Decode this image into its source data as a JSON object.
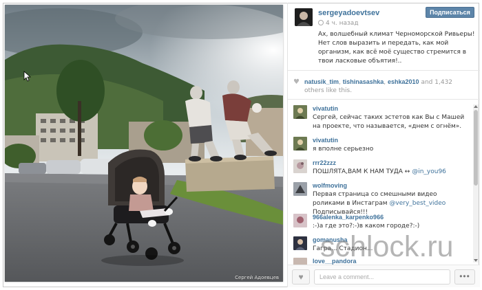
{
  "post": {
    "username": "sergeyadoevtsev",
    "time_ago": "4 ч. назад",
    "follow_label": "Подписаться",
    "caption": "Ах, волшебный климат Черноморской Ривьеры! Нет слов выразить и передать, как мой организм, как всё моё существо стремится в твои ласковые объятия!..",
    "photo_credit": "Сергей Адоевцев"
  },
  "likes": {
    "user1": "natusik_tim",
    "user2": "tishinasashka",
    "user3": "eshka2010",
    "and_text": "and",
    "count": "1,432",
    "others_text": "others like this."
  },
  "comments": [
    {
      "user": "vivatutin",
      "text": "Сергей, сейчас таких эстетов как Вы с Машей на проекте, что называется, «днем с огнём»."
    },
    {
      "user": "vivatutin",
      "text": "я вполне серьезно"
    },
    {
      "user": "rrr22zzz",
      "text_before": "ПОШЛЯТА,ВАМ К НАМ ТУДА ↔ ",
      "mention": "@in_you96",
      "text_after": ""
    },
    {
      "user": "wolfmoving",
      "text_before": "Первая страница со смешными видео роликами в Инстаграм ",
      "mention": "@very_best_video",
      "text_after": " Подписывайся!!!"
    },
    {
      "user": "966alenka_karpenko966",
      "text": ":-)а где это?:-)в каком городе?:-)"
    },
    {
      "user": "gomanusha",
      "text": "Гагра... Стадион..."
    },
    {
      "user": "love__pandora",
      "text": ""
    }
  ],
  "footer": {
    "placeholder": "Leave a comment...",
    "more_label": "•••"
  },
  "watermark": "schlock.ru",
  "icons": {
    "heart": "heart-icon",
    "clock": "clock-icon",
    "more": "more-dots-icon"
  },
  "colors": {
    "link": "#3f729b",
    "button": "#5d85a9"
  }
}
